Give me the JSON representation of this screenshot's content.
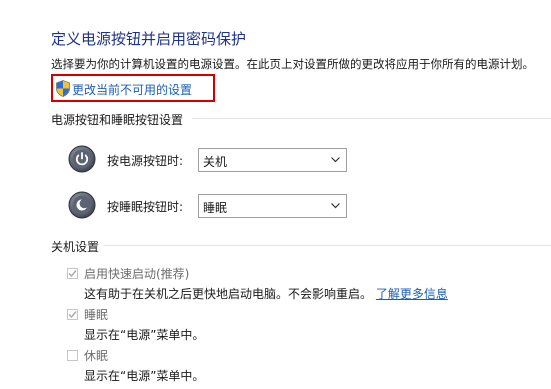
{
  "header": {
    "title": "定义电源按钮并启用密码保护",
    "intro": "选择要为你的计算机设置的电源设置。在此页上对设置所做的更改将应用于你所有的电源计划。",
    "change_link": "更改当前不可用的设置"
  },
  "power_buttons": {
    "section_title": "电源按钮和睡眠按钮设置",
    "rows": [
      {
        "label": "按电源按钮时:",
        "value": "关机",
        "icon": "power-button-icon"
      },
      {
        "label": "按睡眠按钮时:",
        "value": "睡眠",
        "icon": "sleep-button-icon"
      }
    ]
  },
  "shutdown": {
    "section_title": "关机设置",
    "options": [
      {
        "label": "启用快速启动(推荐)",
        "checked": true,
        "desc": "这有助于在关机之后更快地启动电脑。不会影响重启。",
        "link": "了解更多信息"
      },
      {
        "label": "睡眠",
        "checked": true,
        "desc": "显示在“电源”菜单中。"
      },
      {
        "label": "休眠",
        "checked": false,
        "desc": "显示在“电源”菜单中。"
      }
    ]
  },
  "colors": {
    "title": "#1e3287",
    "link": "#1a5fb4",
    "highlight_border": "#d40000"
  }
}
